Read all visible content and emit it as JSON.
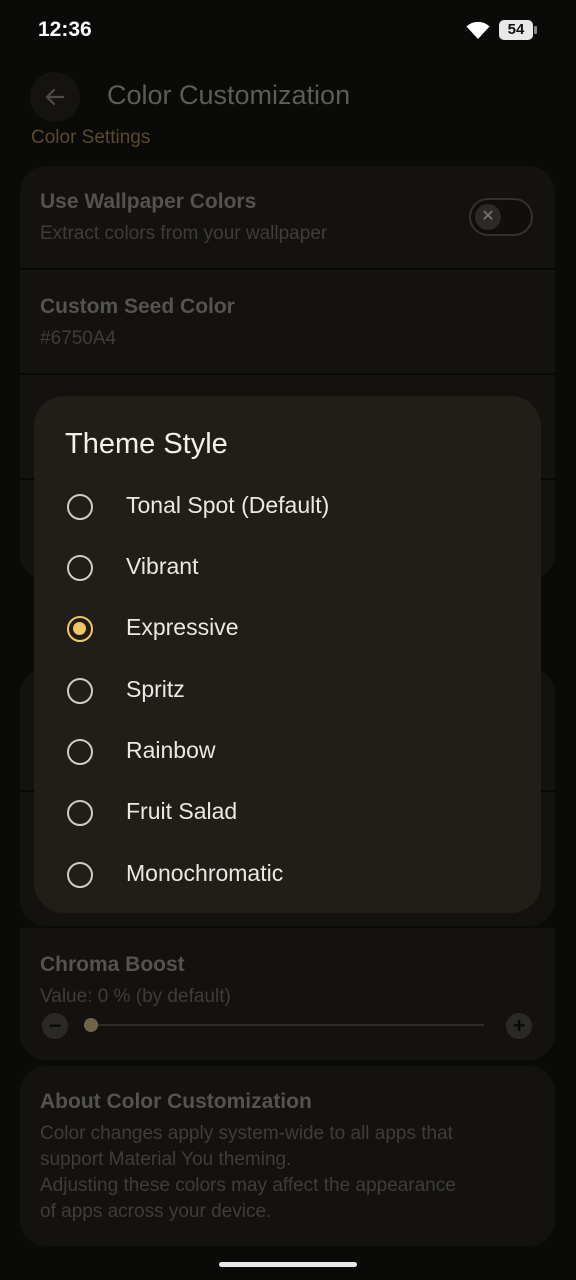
{
  "status_bar": {
    "time": "12:36",
    "battery": "54",
    "wifi_icon": "wifi-icon"
  },
  "app_bar": {
    "title": "Color Customization",
    "back_icon": "arrow-back-icon"
  },
  "settings": {
    "section_label": "Color Settings",
    "use_wallpaper": {
      "title": "Use Wallpaper Colors",
      "subtitle": "Extract colors from your wallpaper",
      "enabled": false
    },
    "seed_color": {
      "title": "Custom Seed Color",
      "value": "#6750A4"
    },
    "chroma_boost": {
      "title": "Chroma Boost",
      "value_text": "Value: 0 % (by default)",
      "value": 0
    },
    "about": {
      "title": "About Color Customization",
      "lines": [
        "Color changes apply system-wide to all apps that",
        "support Material You theming.",
        "Adjusting these colors may affect the appearance",
        "of apps across your device."
      ]
    }
  },
  "dialog": {
    "title": "Theme Style",
    "selected": "Expressive",
    "options": [
      "Tonal Spot (Default)",
      "Vibrant",
      "Expressive",
      "Spritz",
      "Rainbow",
      "Fruit Salad",
      "Monochromatic"
    ]
  },
  "colors": {
    "accent": "#f0c669",
    "dialog_bg": "#211e17",
    "scrim_bg": "#0a0a08"
  }
}
